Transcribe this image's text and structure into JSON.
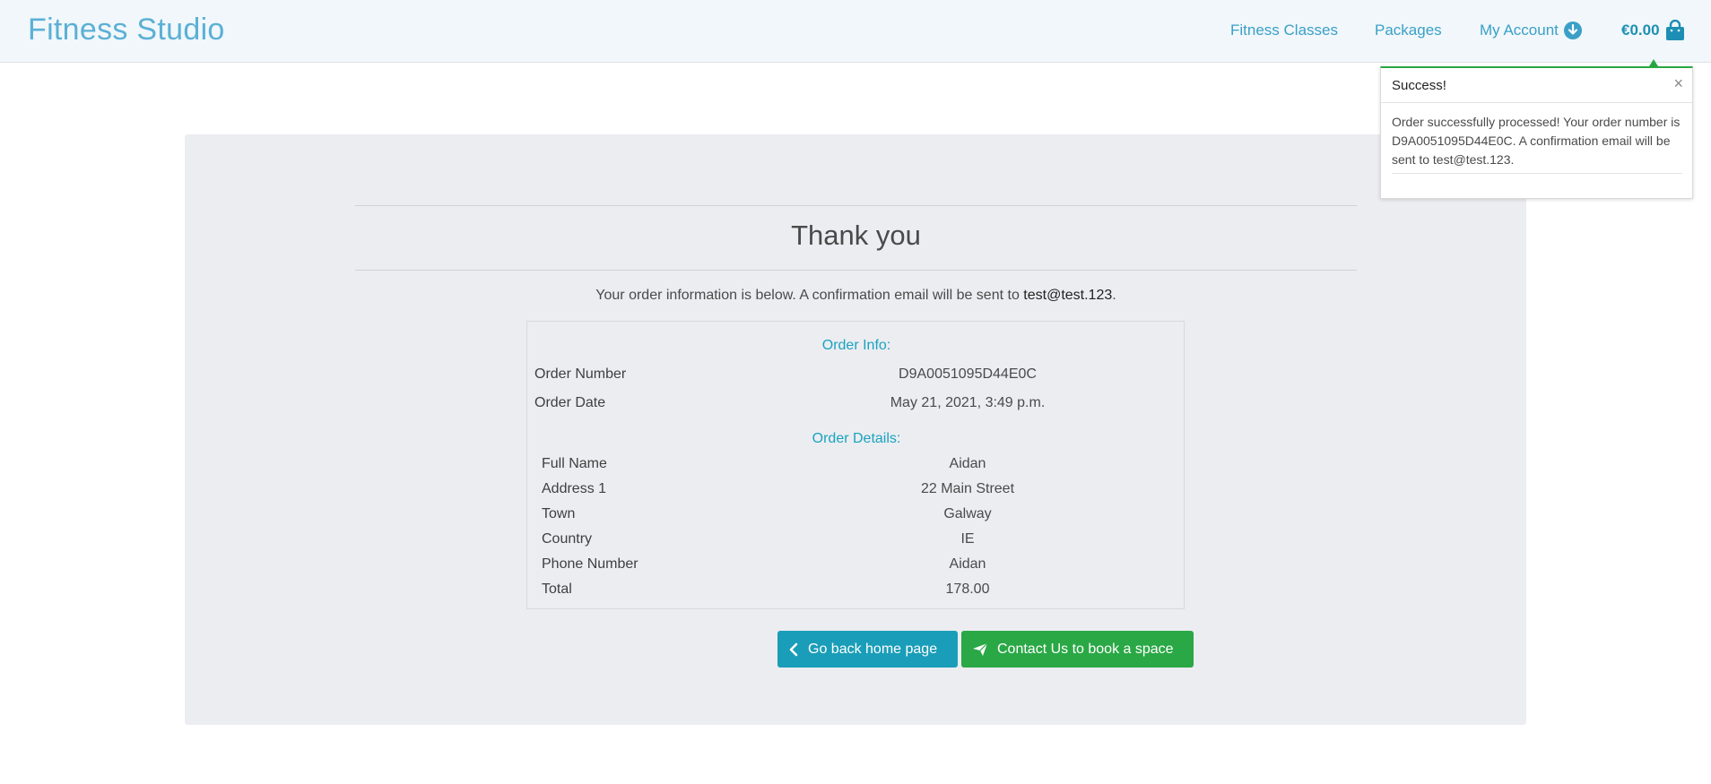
{
  "navbar": {
    "brand": "Fitness Studio",
    "links": [
      "Fitness Classes",
      "Packages",
      "My Account"
    ],
    "cart_total": "€0.00"
  },
  "toast": {
    "title": "Success!",
    "close": "×",
    "message": "Order successfully processed! Your order number is D9A0051095D44E0C. A confirmation email will be sent to test@test.123."
  },
  "main": {
    "title": "Thank you",
    "intro_text": "Your order information is below. A confirmation email will be sent to ",
    "intro_email": "test@test.123",
    "intro_end": "."
  },
  "order_info": {
    "title": "Order Info:",
    "rows": [
      {
        "label": "Order Number",
        "value": "D9A0051095D44E0C"
      },
      {
        "label": "Order Date",
        "value": "May 21, 2021, 3:49 p.m."
      }
    ]
  },
  "order_details": {
    "title": "Order Details:",
    "rows": [
      {
        "label": "Full Name",
        "value": "Aidan"
      },
      {
        "label": "Address 1",
        "value": "22 Main Street"
      },
      {
        "label": "Town",
        "value": "Galway"
      },
      {
        "label": "Country",
        "value": "IE"
      },
      {
        "label": "Phone Number",
        "value": "Aidan"
      },
      {
        "label": "Total",
        "value": "178.00"
      }
    ]
  },
  "buttons": {
    "home": "Go back home page",
    "contact": "Contact Us to book a space"
  }
}
